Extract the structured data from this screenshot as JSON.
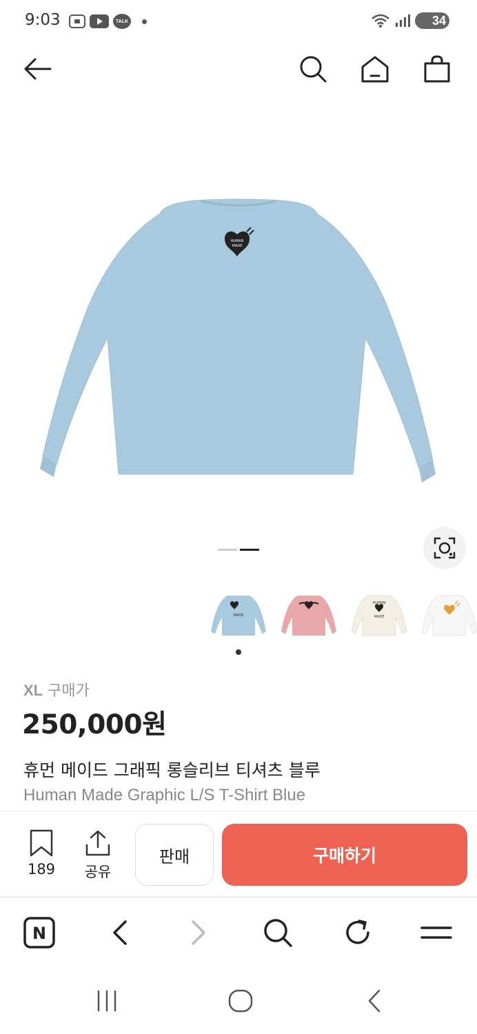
{
  "status": {
    "time": "9:03",
    "talk_label": "TALK",
    "battery": "34"
  },
  "product": {
    "size": "XL",
    "price_label": "구매가",
    "price": "250,000원",
    "name_ko": "휴먼 메이드 그래픽 롱슬리브 티셔츠 블루",
    "name_en": "Human Made Graphic L/S T-Shirt Blue",
    "main_color": "#a9c9de",
    "logo_text": "HUMAN MADE"
  },
  "thumbnails": [
    {
      "color": "#a9c9de",
      "label": "blue"
    },
    {
      "color": "#e8a7ab",
      "label": "pink"
    },
    {
      "color": "#f3efe4",
      "label": "cream"
    },
    {
      "color": "#f6f6f6",
      "label": "white"
    }
  ],
  "actions": {
    "bookmark_count": "189",
    "share_label": "공유",
    "sell_label": "판매",
    "buy_label": "구매하기",
    "buy_color": "#ef6253"
  },
  "browser": {
    "n_label": "N"
  }
}
